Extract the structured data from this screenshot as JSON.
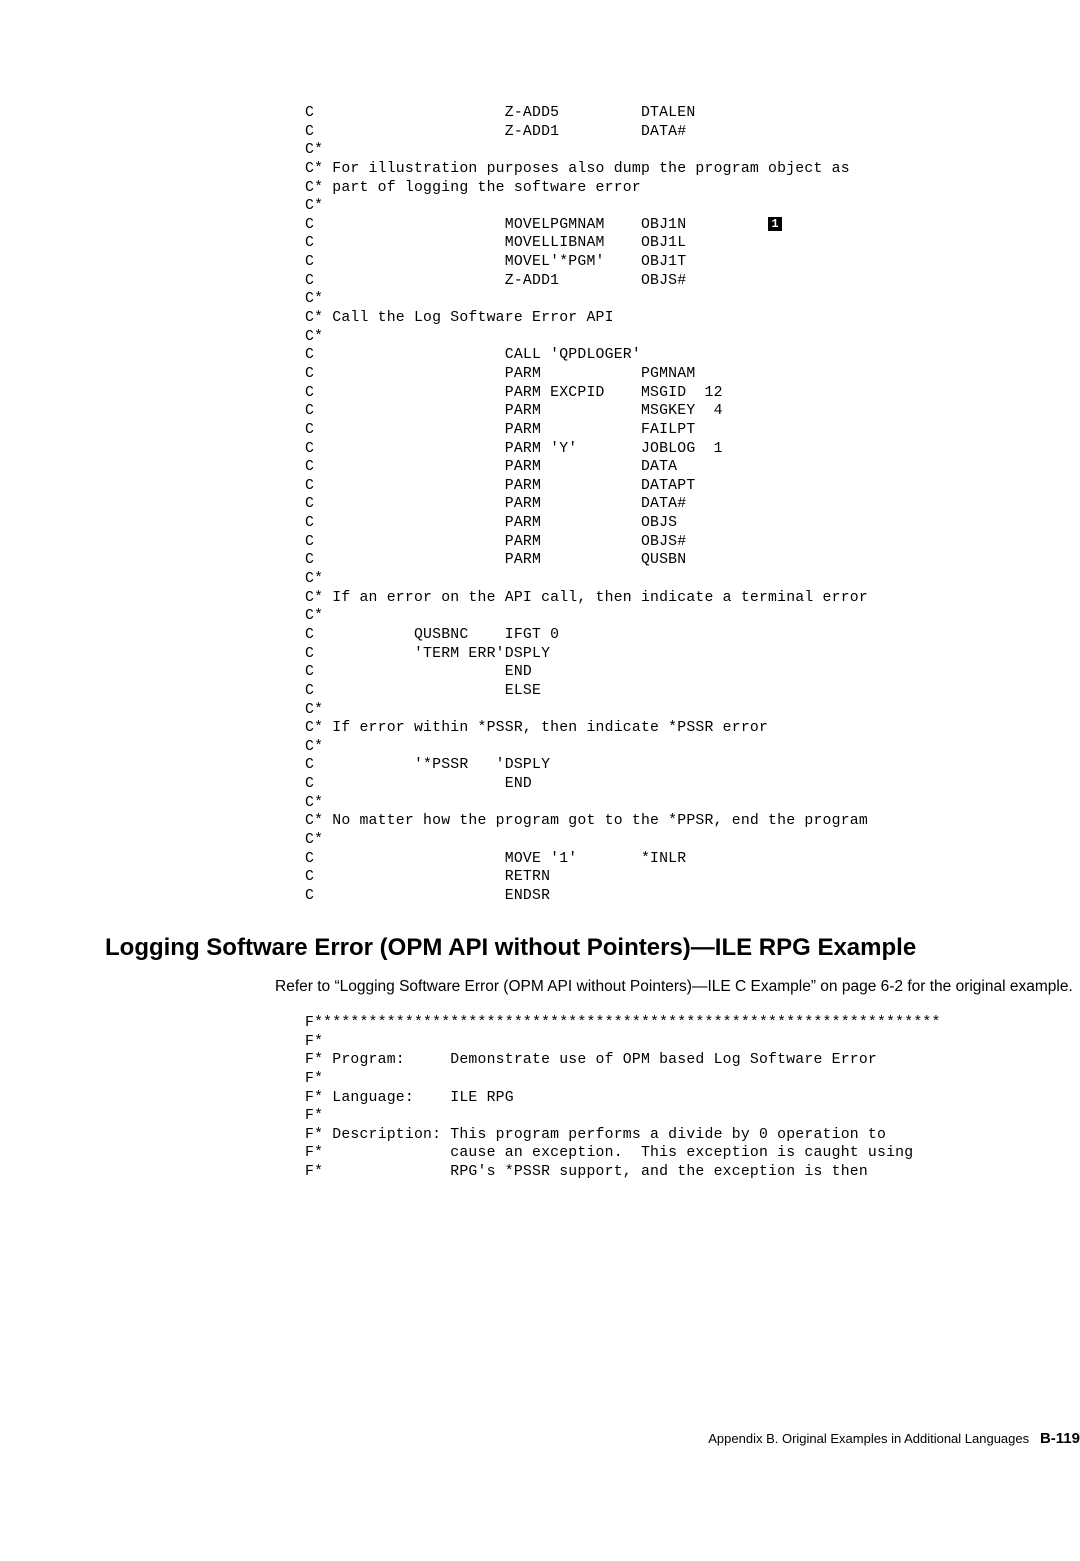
{
  "code1": {
    "l01": "C                     Z-ADD5         DTALEN",
    "l02": "C                     Z-ADD1         DATA#",
    "l03": "C*",
    "l04": "C* For illustration purposes also dump the program object as",
    "l05": "C* part of logging the software error",
    "l06": "C*",
    "l07a": "C                     MOVELPGMNAM    OBJ1N         ",
    "callout1": "1",
    "l08": "C                     MOVELLIBNAM    OBJ1L",
    "l09": "C                     MOVEL'*PGM'    OBJ1T",
    "l10": "C                     Z-ADD1         OBJS#",
    "l11": "C*",
    "l12": "C* Call the Log Software Error API",
    "l13": "C*",
    "l14": "C                     CALL 'QPDLOGER'",
    "l15": "C                     PARM           PGMNAM",
    "l16": "C                     PARM EXCPID    MSGID  12",
    "l17": "C                     PARM           MSGKEY  4",
    "l18": "C                     PARM           FAILPT",
    "l19": "C                     PARM 'Y'       JOBLOG  1",
    "l20": "C                     PARM           DATA",
    "l21": "C                     PARM           DATAPT",
    "l22": "C                     PARM           DATA#",
    "l23": "C                     PARM           OBJS",
    "l24": "C                     PARM           OBJS#",
    "l25": "C                     PARM           QUSBN",
    "l26": "C*",
    "l27": "C* If an error on the API call, then indicate a terminal error",
    "l28": "C*",
    "l29": "C           QUSBNC    IFGT 0",
    "l30": "C           'TERM ERR'DSPLY",
    "l31": "C                     END",
    "l32": "C                     ELSE",
    "l33": "C*",
    "l34": "C* If error within *PSSR, then indicate *PSSR error",
    "l35": "C*",
    "l36": "C           '*PSSR   'DSPLY",
    "l37": "C                     END",
    "l38": "C*",
    "l39": "C* No matter how the program got to the *PPSR, end the program",
    "l40": "C*",
    "l41": "C                     MOVE '1'       *INLR",
    "l42": "C                     RETRN",
    "l43": "C                     ENDSR"
  },
  "heading": "Logging Software Error (OPM API without Pointers)—ILE RPG Example",
  "body": "Refer to “Logging Software Error (OPM API without Pointers)—ILE C Example” on page 6-2 for the original example.",
  "code2": {
    "l01": "F*********************************************************************",
    "l02": "F*",
    "l03": "F* Program:     Demonstrate use of OPM based Log Software Error",
    "l04": "F*",
    "l05": "F* Language:    ILE RPG",
    "l06": "F*",
    "l07": "F* Description: This program performs a divide by 0 operation to",
    "l08": "F*              cause an exception.  This exception is caught using",
    "l09": "F*              RPG's *PSSR support, and the exception is then"
  },
  "footer": {
    "text": "Appendix B. Original Examples in Additional Languages",
    "pagenum": "B-119"
  }
}
